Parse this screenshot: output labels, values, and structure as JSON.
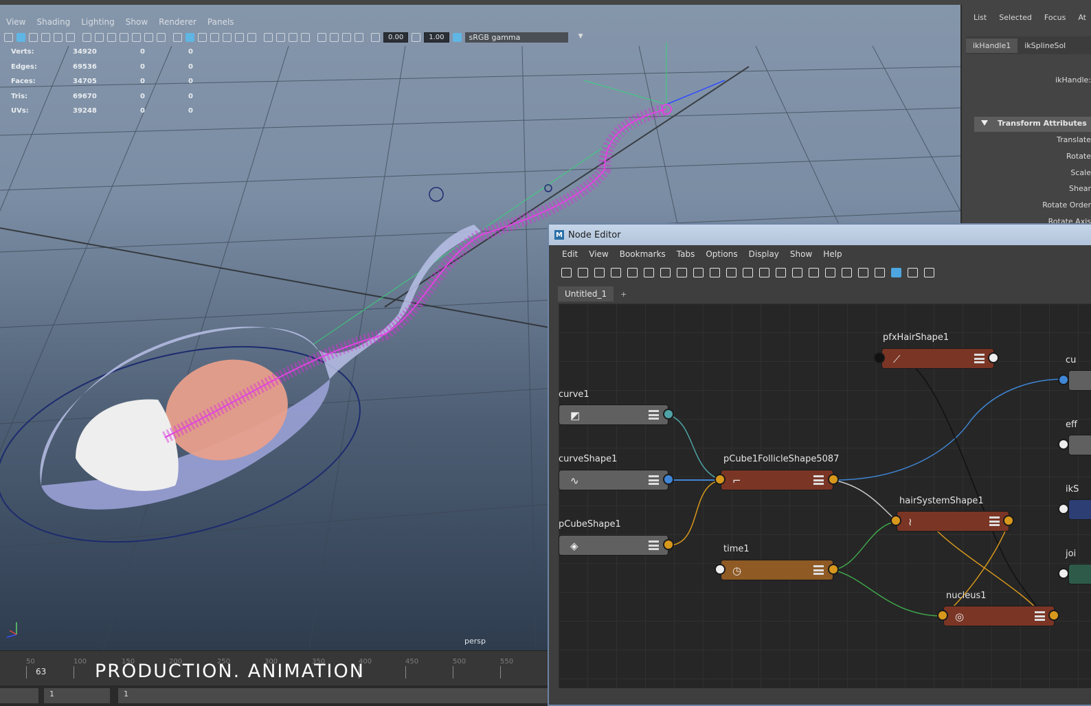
{
  "viewport": {
    "menu": [
      "View",
      "Shading",
      "Lighting",
      "Show",
      "Renderer",
      "Panels"
    ],
    "field1": "0.00",
    "field2": "1.00",
    "color_space": "sRGB gamma",
    "hud": [
      {
        "label": "Verts:",
        "v1": "34920",
        "v2": "0",
        "v3": "0"
      },
      {
        "label": "Edges:",
        "v1": "69536",
        "v2": "0",
        "v3": "0"
      },
      {
        "label": "Faces:",
        "v1": "34705",
        "v2": "0",
        "v3": "0"
      },
      {
        "label": "Tris:",
        "v1": "69670",
        "v2": "0",
        "v3": "0"
      },
      {
        "label": "UVs:",
        "v1": "39248",
        "v2": "0",
        "v3": "0"
      }
    ],
    "camera": "persp"
  },
  "timeline": {
    "ticks": [
      "50",
      "100",
      "150",
      "200",
      "250",
      "300",
      "350",
      "400",
      "450",
      "500",
      "550"
    ],
    "current_frame": "63",
    "range_start": "1",
    "range_start2": "1"
  },
  "banner": "PRODUCTION. ANIMATION",
  "attribute_editor": {
    "top_menu": [
      "List",
      "Selected",
      "Focus",
      "At"
    ],
    "tabs": [
      "ikHandle1",
      "ikSplineSol"
    ],
    "node_label": "ikHandle:",
    "section": "Transform Attributes",
    "attrs": [
      "Translate",
      "Rotate",
      "Scale",
      "Shear",
      "Rotate Order",
      "Rotate Axis"
    ]
  },
  "node_editor": {
    "title": "Node Editor",
    "menu": [
      "Edit",
      "View",
      "Bookmarks",
      "Tabs",
      "Options",
      "Display",
      "Show",
      "Help"
    ],
    "tab": "Untitled_1",
    "tab_add": "+",
    "nodes": {
      "pfxHairShape1": "pfxHairShape1",
      "curve1": "curve1",
      "curveShape1": "curveShape1",
      "pCube1FollicleShape5087": "pCube1FollicleShape5087",
      "hairSystemShape1": "hairSystemShape1",
      "pCubeShape1": "pCubeShape1",
      "time1": "time1",
      "nucleus1": "nucleus1"
    },
    "edge_labels": [
      "cu",
      "eff",
      "ikS",
      "joi"
    ]
  },
  "colors": {
    "hair_node": "#7a3525",
    "shape_node": "#606060",
    "time_node": "#8f5a24",
    "wire_blue": "#3f86d6",
    "wire_orange": "#d8981c",
    "wire_green": "#3fa64a",
    "rig_magenta": "#d631d6"
  }
}
